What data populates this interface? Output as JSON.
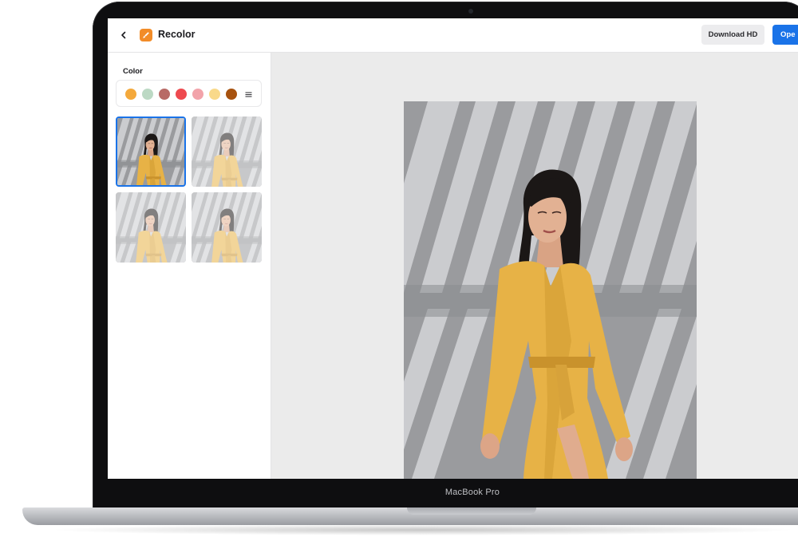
{
  "device": {
    "label": "MacBook Pro"
  },
  "app": {
    "title": "Recolor",
    "back_icon": "chevron-left-icon",
    "logo_icon": "paint-brush-icon",
    "accent_color": "#1a73e8",
    "logo_color": "#f28c28"
  },
  "toolbar": {
    "download_label": "Download HD",
    "open_label": "Ope"
  },
  "sidebar": {
    "color_label": "Color",
    "swatches": [
      "#f4a93c",
      "#bcd9c4",
      "#b86a66",
      "#ee4a4f",
      "#f2a3aa",
      "#f9d98a",
      "#a7520f"
    ],
    "more_icon": "menu-lines-icon",
    "thumbnails": [
      {
        "selected": true
      },
      {
        "selected": false
      },
      {
        "selected": false
      },
      {
        "selected": false
      }
    ]
  },
  "canvas": {
    "photo_subject": "woman-in-yellow-wrap-dress"
  }
}
